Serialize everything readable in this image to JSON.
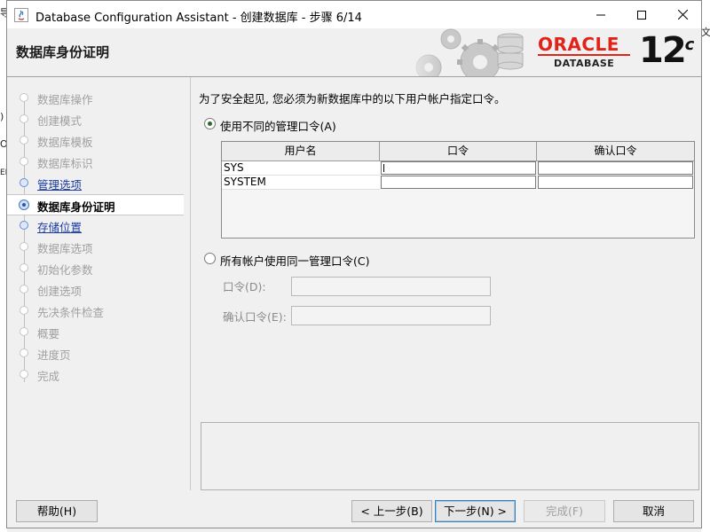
{
  "window": {
    "title": "Database Configuration Assistant - 创建数据库 - 步骤 6/14"
  },
  "header": {
    "page_title": "数据库身份证明",
    "logo_word": "ORACLE",
    "logo_sub": "DATABASE",
    "version": "12",
    "version_suffix": "c"
  },
  "steps": [
    {
      "label": "数据库操作",
      "state": "disabled"
    },
    {
      "label": "创建模式",
      "state": "disabled"
    },
    {
      "label": "数据库模板",
      "state": "disabled"
    },
    {
      "label": "数据库标识",
      "state": "disabled"
    },
    {
      "label": "管理选项",
      "state": "link"
    },
    {
      "label": "数据库身份证明",
      "state": "current"
    },
    {
      "label": "存储位置",
      "state": "link"
    },
    {
      "label": "数据库选项",
      "state": "disabled"
    },
    {
      "label": "初始化参数",
      "state": "disabled"
    },
    {
      "label": "创建选项",
      "state": "disabled"
    },
    {
      "label": "先决条件检查",
      "state": "disabled"
    },
    {
      "label": "概要",
      "state": "disabled"
    },
    {
      "label": "进度页",
      "state": "disabled"
    },
    {
      "label": "完成",
      "state": "disabled"
    }
  ],
  "main": {
    "instruction": "为了安全起见, 您必须为新数据库中的以下用户帐户指定口令。",
    "option_different": "使用不同的管理口令(A)",
    "option_same": "所有帐户使用同一管理口令(C)",
    "selected_option": "different",
    "table": {
      "headers": [
        "用户名",
        "口令",
        "确认口令"
      ],
      "rows": [
        {
          "user": "SYS",
          "password": "",
          "confirm": ""
        },
        {
          "user": "SYSTEM",
          "password": "",
          "confirm": ""
        }
      ]
    },
    "password_label": "口令(D):",
    "confirm_label": "确认口令(E):",
    "password_value": "",
    "confirm_value": ""
  },
  "buttons": {
    "help": "帮助(H)",
    "back": "< 上一步(B)",
    "next": "下一步(N) >",
    "finish": "完成(F)",
    "cancel": "取消"
  },
  "background_fragments": {
    "left": [
      "导",
      ")",
      "O",
      "EM"
    ],
    "right": [
      "文"
    ]
  }
}
